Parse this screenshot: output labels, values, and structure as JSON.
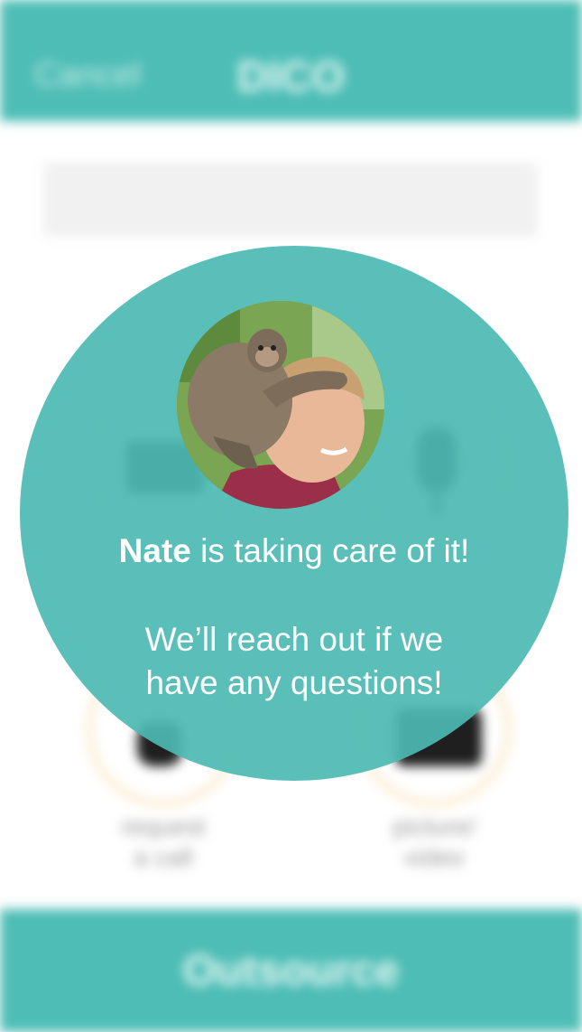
{
  "header": {
    "cancel_label": "Cancel",
    "app_title": "DICO"
  },
  "colors": {
    "teal": "#4dbdb5",
    "overlay": "#4cbab2",
    "option_ring": "#fbe7c4"
  },
  "options": [
    {
      "icon": "keyboard-icon"
    },
    {
      "icon": "microphone-icon"
    },
    {
      "icon": "phone-icon",
      "label_lines": [
        "request",
        "a call"
      ]
    },
    {
      "icon": "camera-icon",
      "label_lines": [
        "picture/",
        "video"
      ]
    }
  ],
  "footer": {
    "outsource_label": "Outsource"
  },
  "confirmation": {
    "assignee": "Nate",
    "status_rest": " is taking care of it!",
    "followup_lines": [
      "We’ll reach out if we",
      "have any questions!"
    ],
    "avatar_icon": "nate-avatar"
  }
}
